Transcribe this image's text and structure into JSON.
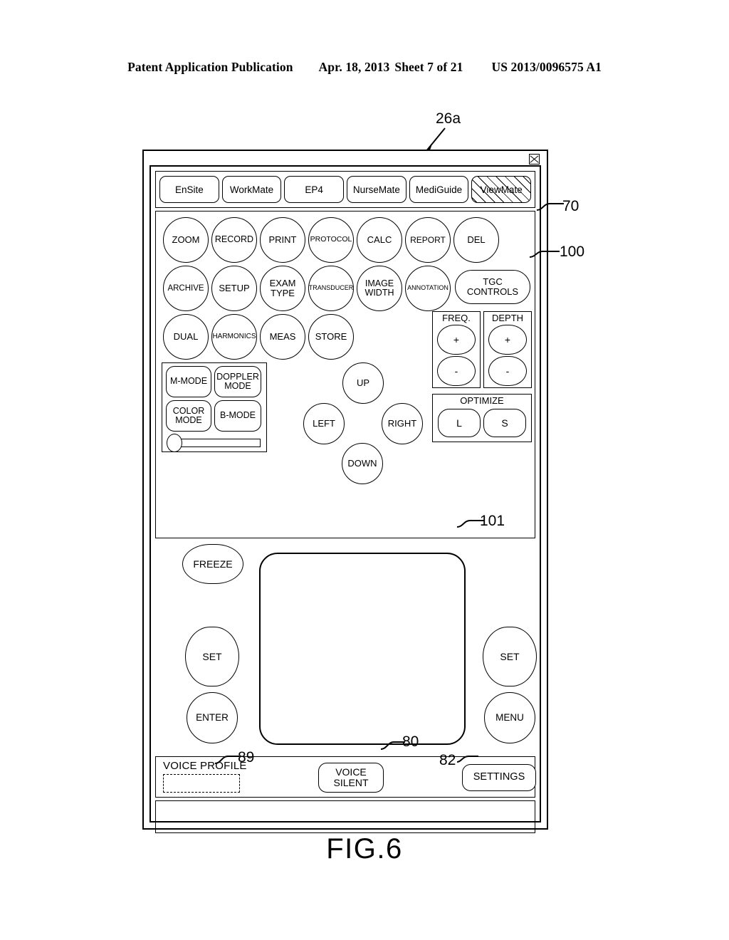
{
  "page_header": {
    "publication": "Patent Application Publication",
    "date": "Apr. 18, 2013",
    "sheet": "Sheet 7 of 21",
    "number": "US 2013/0096575 A1"
  },
  "figure": {
    "caption": "FIG.6",
    "callouts": {
      "device": "26a",
      "tabbar": "70",
      "panel": "100",
      "touchpad": "101",
      "voice_profile": "89",
      "voice_silent": "80",
      "settings": "82"
    }
  },
  "window": {
    "close_icon": "close-icon"
  },
  "tabs": [
    {
      "label": "EnSite",
      "selected": false
    },
    {
      "label": "WorkMate",
      "selected": false
    },
    {
      "label": "EP4",
      "selected": false
    },
    {
      "label": "NurseMate",
      "selected": false
    },
    {
      "label": "MediGuide",
      "selected": false
    },
    {
      "label": "ViewMate",
      "selected": true
    }
  ],
  "controls": {
    "row1": [
      {
        "label": "ZOOM"
      },
      {
        "label": "RECORD"
      },
      {
        "label": "PRINT"
      },
      {
        "label": "PROTOCOL"
      },
      {
        "label": "CALC"
      },
      {
        "label": "REPORT"
      },
      {
        "label": "DEL"
      }
    ],
    "row2": [
      {
        "label": "ARCHIVE"
      },
      {
        "label": "SETUP"
      },
      {
        "label": "EXAM\nTYPE"
      },
      {
        "label": "TRANSDUCER"
      },
      {
        "label": "IMAGE\nWIDTH"
      },
      {
        "label": "ANNOTATION"
      }
    ],
    "tgc": {
      "label": "TGC\nCONTROLS"
    },
    "row3": [
      {
        "label": "DUAL"
      },
      {
        "label": "HARMONICS"
      },
      {
        "label": "MEAS"
      },
      {
        "label": "STORE"
      }
    ],
    "modes": [
      {
        "label": "M-MODE"
      },
      {
        "label": "DOPPLER\nMODE"
      },
      {
        "label": "COLOR\nMODE"
      },
      {
        "label": "B-MODE"
      }
    ],
    "dpad": {
      "up": "UP",
      "left": "LEFT",
      "right": "RIGHT",
      "down": "DOWN"
    },
    "freq": {
      "title": "FREQ.",
      "plus": "+",
      "minus": "-"
    },
    "depth": {
      "title": "DEPTH",
      "plus": "+",
      "minus": "-"
    },
    "optimize": {
      "title": "OPTIMIZE",
      "large": "L",
      "small": "S"
    },
    "freeze": {
      "label": "FREEZE"
    },
    "set_left": {
      "label": "SET"
    },
    "enter": {
      "label": "ENTER"
    },
    "set_right": {
      "label": "SET"
    },
    "menu": {
      "label": "MENU"
    }
  },
  "bottom_bar": {
    "voice_profile_label": "VOICE PROFILE",
    "voice_profile_value": "",
    "voice_silent": "VOICE\nSILENT",
    "settings": "SETTINGS"
  }
}
